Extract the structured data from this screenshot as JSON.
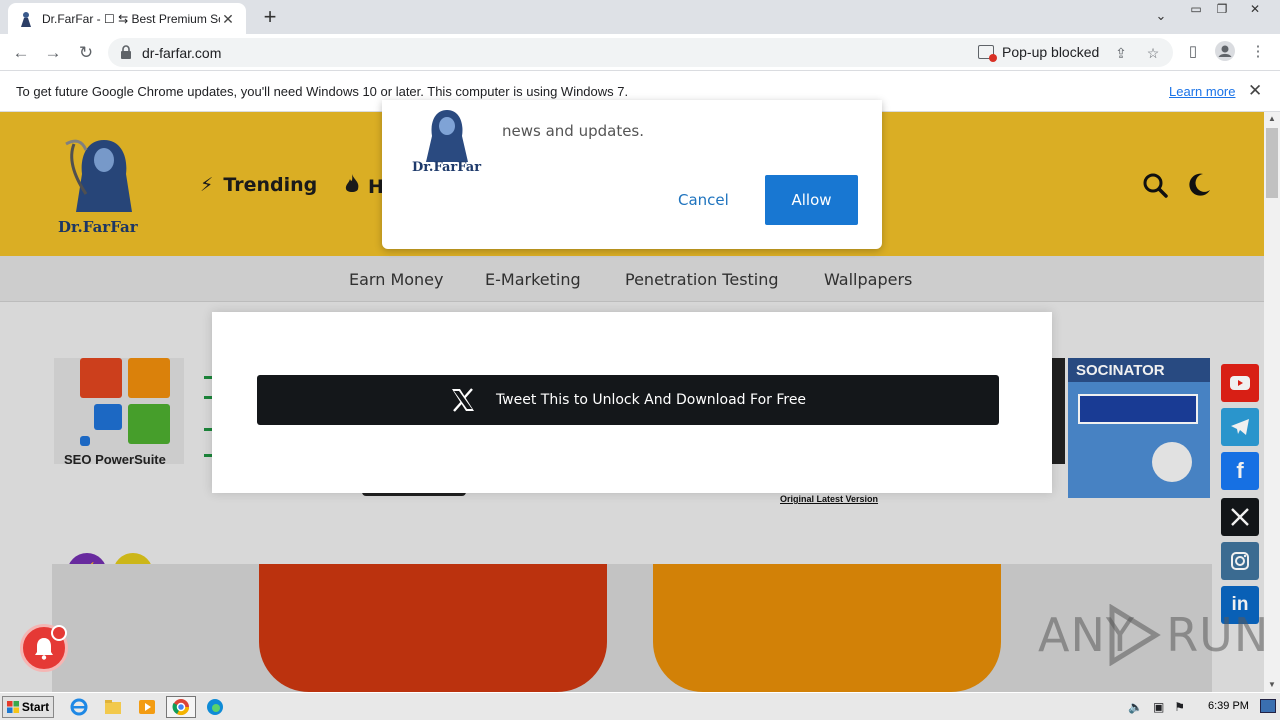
{
  "browser": {
    "tab_title": "Dr.FarFar - ☐ ⇆ Best Premium Softw",
    "url": "dr-farfar.com",
    "popup_blocked": "Pop-up blocked"
  },
  "infobar": {
    "message": "To get future Google Chrome updates, you'll need Windows 10 or later. This computer is using Windows 7.",
    "learn_more": "Learn more"
  },
  "site": {
    "logo_text": "Dr.FarFar",
    "nav": [
      "Trending",
      "H"
    ],
    "categories": [
      "Earn Money",
      "E-Marketing",
      "Penetration Testing",
      "Wallpapers"
    ],
    "seo_label": "SEO PowerSuite",
    "socinator": "SOCINATOR",
    "orig_text": "Original Latest Version"
  },
  "notification": {
    "text": "news and updates.",
    "cancel": "Cancel",
    "allow": "Allow"
  },
  "locker": {
    "button": "Tweet This to Unlock And Download For Free"
  },
  "watermark": {
    "text": "ANY  RUN"
  },
  "taskbar": {
    "start": "Start",
    "clock": "6:39 PM"
  },
  "colors": {
    "header_bg": "#e8b927",
    "allow_blue": "#1877d2",
    "youtube": "#e62117",
    "telegram": "#2d9fd9",
    "facebook": "#1877f2",
    "x": "#14171a",
    "instagram": "#3f729b",
    "linkedin": "#0a66c2"
  }
}
